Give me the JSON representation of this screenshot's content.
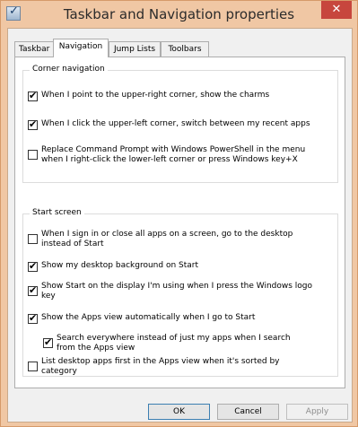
{
  "window": {
    "title": "Taskbar and Navigation properties",
    "close_glyph": "✕"
  },
  "tabs": [
    {
      "label": "Taskbar"
    },
    {
      "label": "Navigation"
    },
    {
      "label": "Jump Lists"
    },
    {
      "label": "Toolbars"
    }
  ],
  "corner": {
    "title": "Corner navigation",
    "options": [
      {
        "lines": [
          "When I point to the upper-right corner, show the charms"
        ],
        "checked": true
      },
      {
        "lines": [
          "When I click the upper-left corner, switch between my recent apps"
        ],
        "checked": true
      },
      {
        "lines": [
          "Replace Command Prompt with Windows PowerShell in the menu",
          "when I right-click the lower-left corner or press Windows key+X"
        ],
        "checked": false
      }
    ]
  },
  "start": {
    "title": "Start screen",
    "options": [
      {
        "lines": [
          "When I sign in or close all apps on a screen, go to the desktop",
          "instead of Start"
        ],
        "checked": false
      },
      {
        "lines": [
          "Show my desktop background on Start"
        ],
        "checked": true
      },
      {
        "lines": [
          "Show Start on the display I'm using when I press the Windows logo",
          "key"
        ],
        "checked": true
      },
      {
        "lines": [
          "Show the Apps view automatically when I go to Start"
        ],
        "checked": true
      },
      {
        "lines": [
          "Search everywhere instead of just my apps when I search",
          "from the Apps view"
        ],
        "checked": true
      },
      {
        "lines": [
          "List desktop apps first in the Apps view when it's sorted by",
          "category"
        ],
        "checked": false
      }
    ]
  },
  "buttons": {
    "ok": "OK",
    "cancel": "Cancel",
    "apply": "Apply"
  }
}
